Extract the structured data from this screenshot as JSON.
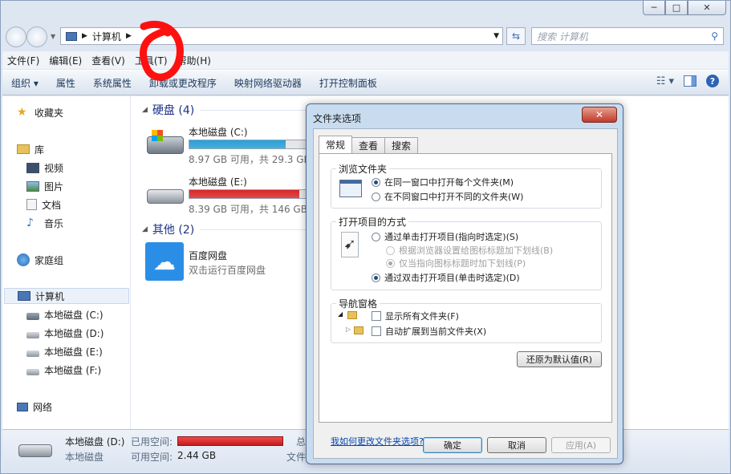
{
  "window": {
    "min": "─",
    "max": "□",
    "close": "✕"
  },
  "address": {
    "crumb": "计算机",
    "search_placeholder": "搜索 计算机"
  },
  "menu": [
    "文件(F)",
    "编辑(E)",
    "查看(V)",
    "工具(T)",
    "帮助(H)"
  ],
  "toolbar": [
    "组织 ▾",
    "属性",
    "系统属性",
    "卸载或更改程序",
    "映射网络驱动器",
    "打开控制面板"
  ],
  "sidebar": {
    "favorites": "收藏夹",
    "libraries": "库",
    "lib_items": [
      "视频",
      "图片",
      "文档",
      "音乐"
    ],
    "homegroup": "家庭组",
    "computer": "计算机",
    "drives": [
      "本地磁盘 (C:)",
      "本地磁盘 (D:)",
      "本地磁盘 (E:)",
      "本地磁盘 (F:)"
    ],
    "network": "网络"
  },
  "main": {
    "group_disks": "硬盘 (4)",
    "group_other": "其他 (2)",
    "drives": [
      {
        "name": "本地磁盘 (C:)",
        "info": "8.97 GB 可用，共 29.3 GB",
        "used_fraction": 0.82,
        "color": "#26a0da"
      },
      {
        "name": "本地磁盘 (E:)",
        "info": "8.39 GB 可用，共 146 GB",
        "used_fraction": 0.94,
        "color": "#da2626"
      }
    ],
    "other": {
      "name": "百度网盘",
      "desc": "双击运行百度网盘"
    }
  },
  "status": {
    "name": "本地磁盘 (D:)",
    "used_label": "已用空间:",
    "type": "本地磁盘",
    "free_label": "可用空间:",
    "free_value": "2.44 GB",
    "total_prefix": "总",
    "fs_prefix": "文件"
  },
  "dialog": {
    "title": "文件夹选项",
    "tabs": [
      "常规",
      "查看",
      "搜索"
    ],
    "browse": {
      "label": "浏览文件夹",
      "opt1": "在同一窗口中打开每个文件夹(M)",
      "opt2": "在不同窗口中打开不同的文件夹(W)"
    },
    "click": {
      "label": "打开项目的方式",
      "opt1": "通过单击打开项目(指向时选定)(S)",
      "sub1": "根据浏览器设置给图标标题加下划线(B)",
      "sub2": "仅当指向图标标题时加下划线(P)",
      "opt2": "通过双击打开项目(单击时选定)(D)"
    },
    "nav": {
      "label": "导航窗格",
      "cb1": "显示所有文件夹(F)",
      "cb2": "自动扩展到当前文件夹(X)"
    },
    "restore": "还原为默认值(R)",
    "link": "我如何更改文件夹选项?",
    "ok": "确定",
    "cancel": "取消",
    "apply": "应用(A)"
  }
}
